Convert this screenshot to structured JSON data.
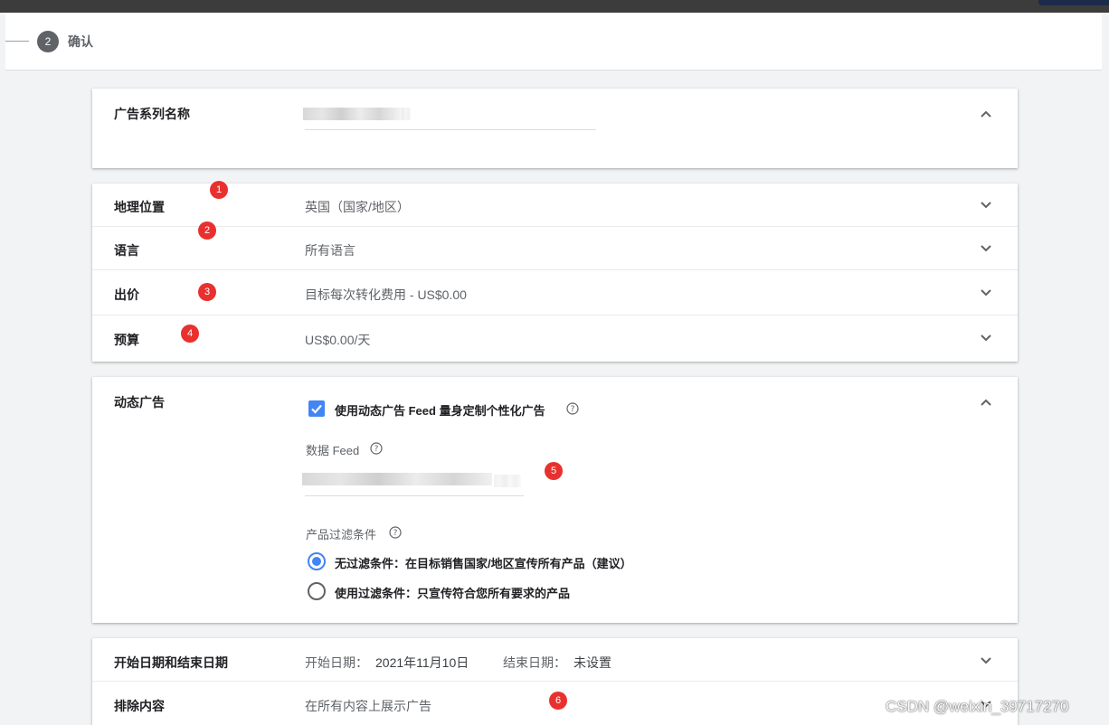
{
  "stepper": {
    "step_number": "2",
    "step_label": "确认"
  },
  "campaign_name": {
    "label": "广告系列名称"
  },
  "settings": {
    "rows": [
      {
        "label": "地理位置",
        "value": "英国（国家/地区）",
        "badge": "1"
      },
      {
        "label": "语言",
        "value": "所有语言",
        "badge": "2"
      },
      {
        "label": "出价",
        "value": "目标每次转化费用 - US$0.00",
        "badge": "3"
      },
      {
        "label": "预算",
        "value": "US$0.00/天",
        "badge": "4"
      }
    ]
  },
  "dynamic_ads": {
    "label": "动态广告",
    "checkbox_label": "使用动态广告 Feed 量身定制个性化广告",
    "checkbox_checked": true,
    "feed_label": "数据 Feed",
    "feed_badge": "5",
    "filter_label": "产品过滤条件",
    "radio_options": [
      {
        "label": "无过滤条件：在目标销售国家/地区宣传所有产品（建议）",
        "selected": true
      },
      {
        "label": "使用过滤条件：只宣传符合您所有要求的产品",
        "selected": false
      }
    ]
  },
  "dates": {
    "label": "开始日期和结束日期",
    "start_prefix": "开始日期：",
    "start_value": "2021年11月10日",
    "end_prefix": "结束日期：",
    "end_value": "未设置"
  },
  "exclusions": {
    "label": "排除内容",
    "value": "在所有内容上展示广告",
    "badge": "6"
  },
  "watermark": "CSDN @weixin_39717270",
  "colors": {
    "accent": "#4285f4",
    "badge": "#e8312f",
    "background": "#f1f3f4"
  }
}
